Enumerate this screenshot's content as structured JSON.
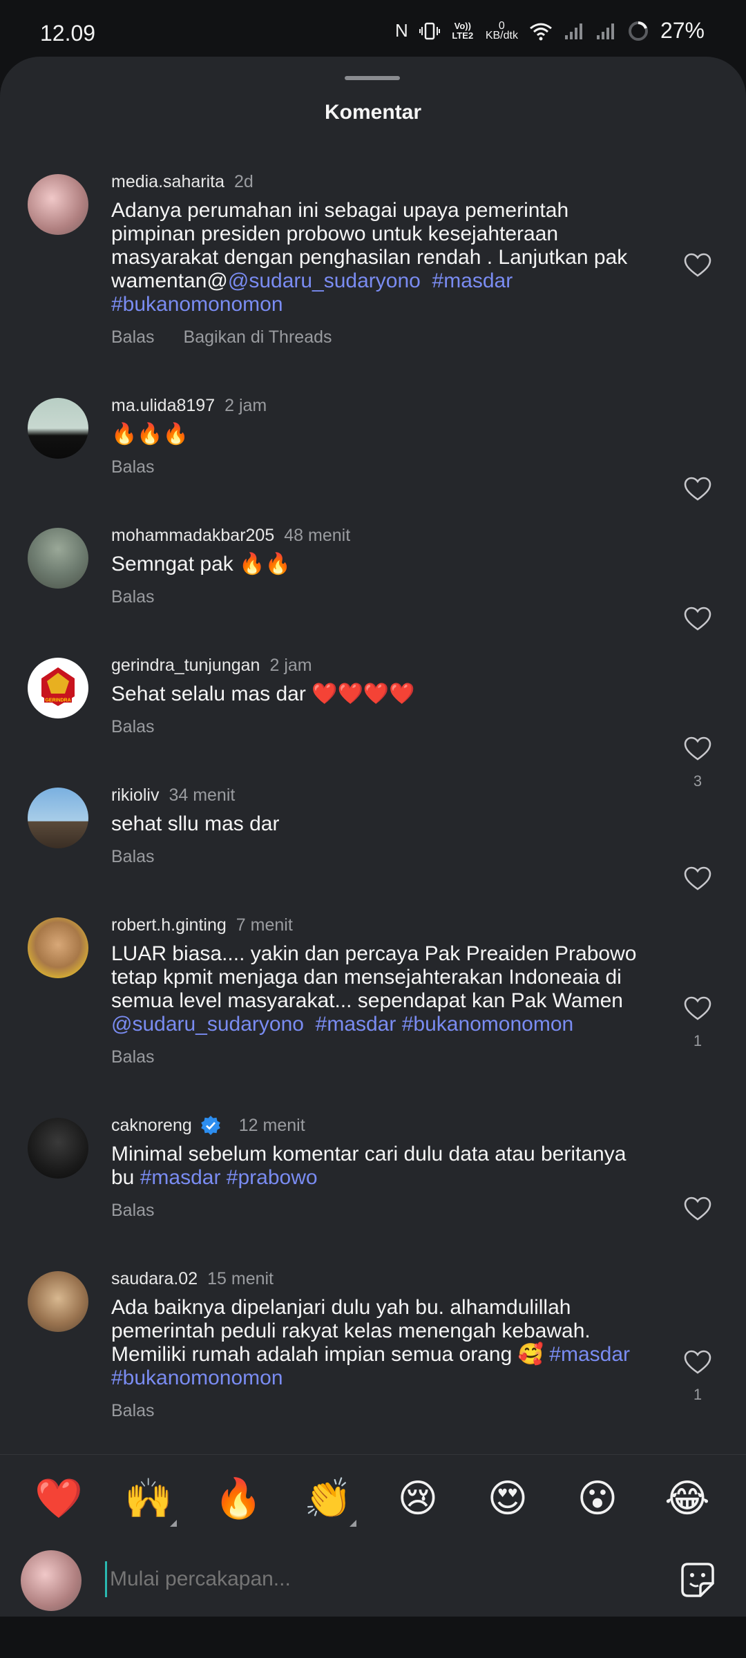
{
  "status": {
    "time": "12.09",
    "nfc": "N",
    "volte": "Vo)) LTE2",
    "net_speed_top": "0",
    "net_speed_bottom": "KB/dtk",
    "battery": "27%"
  },
  "sheet": {
    "title": "Komentar"
  },
  "comments": [
    {
      "username": "media.saharita",
      "time": "2d",
      "text_plain": "Adanya perumahan ini sebagai upaya pemerintah pimpinan presiden probowo untuk kesejahteraan masyarakat dengan penghasilan rendah . Lanjutkan pak wamentan@",
      "mention": "@sudaru_sudaryono",
      "hashtag1": "#masdar",
      "hashtag2": "#bukanomonomon",
      "reply": "Balas",
      "share": "Bagikan di Threads",
      "likes": ""
    },
    {
      "username": "ma.ulida8197",
      "time": "2 jam",
      "text": "🔥🔥🔥",
      "reply": "Balas",
      "likes": ""
    },
    {
      "username": "mohammadakbar205",
      "time": "48 menit",
      "text": "Semngat pak 🔥🔥",
      "reply": "Balas",
      "likes": ""
    },
    {
      "username": "gerindra_tunjungan",
      "time": "2 jam",
      "text": "Sehat selalu mas dar ❤️❤️❤️❤️",
      "reply": "Balas",
      "likes": "3",
      "avatar_label": "GERINDRA"
    },
    {
      "username": "rikioliv",
      "time": "34 menit",
      "text": "sehat sllu mas dar",
      "reply": "Balas",
      "likes": ""
    },
    {
      "username": "robert.h.ginting",
      "time": "7 menit",
      "text_plain": "LUAR biasa.... yakin dan percaya Pak Preaiden Prabowo tetap kpmit menjaga dan mensejahterakan Indoneaia di semua level masyarakat... sependapat kan Pak Wamen ",
      "mention": "@sudaru_sudaryono",
      "hashtag1": "#masdar",
      "hashtag2": "#bukanomonomon",
      "reply": "Balas",
      "likes": "1"
    },
    {
      "username": "caknoreng",
      "verified": true,
      "time": "12 menit",
      "text_plain": "Minimal sebelum komentar cari dulu data atau beritanya bu ",
      "hashtag1": "#masdar",
      "hashtag2": "#prabowo",
      "reply": "Balas",
      "likes": ""
    },
    {
      "username": "saudara.02",
      "time": "15 menit",
      "text_plain": "Ada baiknya dipelanjari dulu yah bu. alhamdulillah pemerintah peduli rakyat kelas menengah kebawah. Memiliki rumah adalah impian semua orang 🥰 ",
      "hashtag1": "#masdar",
      "hashtag2": "#bukanomonomon",
      "reply": "Balas",
      "likes": "1"
    }
  ],
  "reactions": [
    "❤️",
    "🙌",
    "🔥",
    "👏",
    "😢",
    "😍",
    "😮",
    "😂"
  ],
  "composer": {
    "placeholder": "Mulai percakapan..."
  },
  "colors": {
    "sheet_bg": "#25272b",
    "link": "#7a8cf2",
    "muted": "#9a9ca0"
  },
  "icons": {
    "like": "heart-outline-icon",
    "verified": "verified-badge-icon",
    "sticker": "sticker-icon"
  }
}
